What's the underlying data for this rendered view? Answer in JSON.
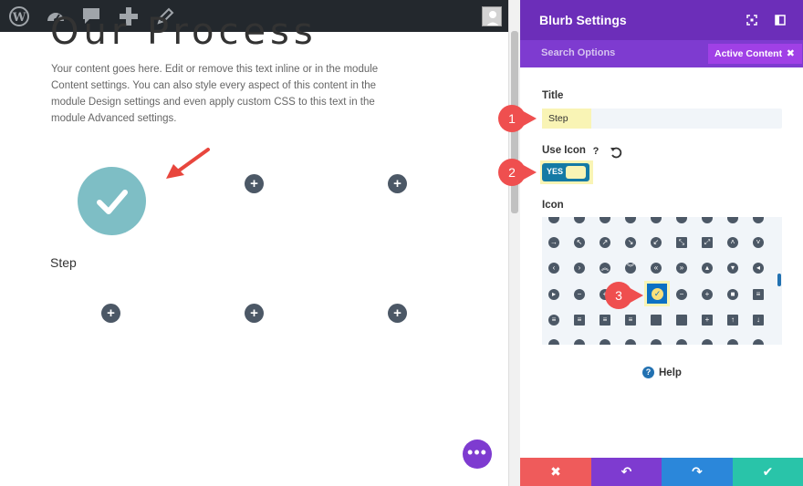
{
  "page": {
    "title": "Our Process",
    "body_text": "Your content goes here. Edit or remove this text inline or in the module Content settings. You can also style every aspect of this content in the module Design settings and even apply custom CSS to this text in the module Advanced settings.",
    "step_label": "Step",
    "add_module_symbol": "+",
    "more_symbol": "•••"
  },
  "admin_bar": {
    "icons": [
      "wordpress-icon",
      "dashboard-icon",
      "comment-icon",
      "plus-icon",
      "pencil-icon",
      "avatar"
    ]
  },
  "panel": {
    "title": "Blurb Settings",
    "search_options": "Search Options",
    "active_content": "Active Content",
    "active_content_close": "✖",
    "title_label": "Title",
    "title_value": "Step",
    "use_icon_label": "Use Icon",
    "use_icon_help": "?",
    "toggle_value": "YES",
    "icon_label": "Icon",
    "help_label": "Help",
    "help_symbol": "?",
    "footer": {
      "cancel": "✖",
      "undo": "↶",
      "redo": "↷",
      "save": "✔"
    }
  },
  "annotations": [
    "1",
    "2",
    "3"
  ],
  "colors": {
    "admin_bar": "#23282d",
    "panel_header": "#6c2eb9",
    "panel_tabs": "#7e3bd0",
    "accent_highlight": "#f9f4b5",
    "toggle_on": "#157aa5",
    "blurb_icon_bg": "#7ebec5",
    "annotation_red": "#ef4f4f",
    "footer_cancel": "#ef5b5b",
    "footer_undo": "#7e3bd0",
    "footer_redo": "#2b87da",
    "footer_save": "#29c4a9"
  }
}
